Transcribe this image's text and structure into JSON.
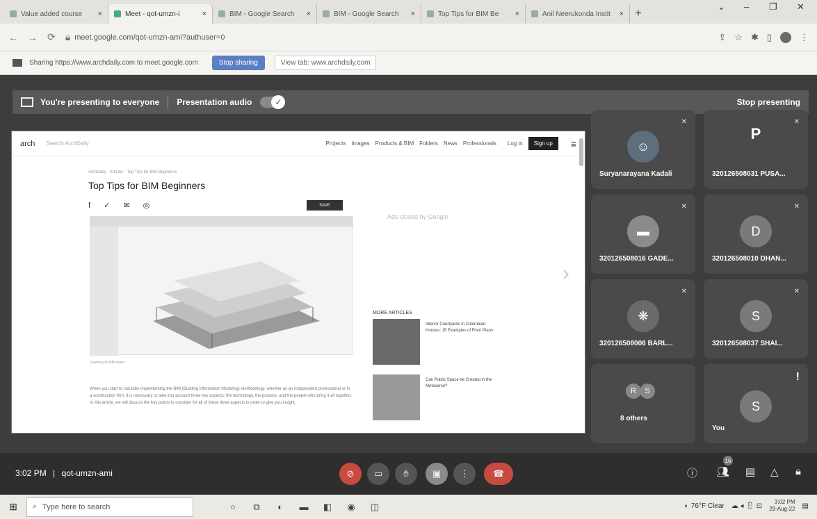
{
  "browser": {
    "tabs": [
      {
        "label": "Value added course",
        "active": false
      },
      {
        "label": "Meet - qot-umzn-i",
        "active": true
      },
      {
        "label": "BIM - Google Search",
        "active": false
      },
      {
        "label": "BIM - Google Search",
        "active": false
      },
      {
        "label": "Top Tips for BIM Be",
        "active": false
      },
      {
        "label": "Anil Neerukonda Instit",
        "active": false
      }
    ],
    "url": "meet.google.com/qot-umzn-ami?authuser=0",
    "sharing_text": "Sharing https://www.archdaily.com to meet.google.com",
    "stop_sharing_label": "Stop sharing",
    "view_tab_label": "View tab: www.archdaily.com"
  },
  "presenting": {
    "message": "You're presenting to everyone",
    "audio_label": "Presentation audio",
    "stop_label": "Stop presenting"
  },
  "shared_page": {
    "logo": "arch",
    "search_placeholder": "Search ArchDaily",
    "nav": [
      "Projects",
      "Images",
      "Products & BIM",
      "Folders",
      "News",
      "Professionals"
    ],
    "login_label": "Log in",
    "signup_label": "Sign up",
    "breadcrumb": "ArchDaily · Articles · Top Tips for BIM Beginners",
    "article_title": "Top Tips for BIM Beginners",
    "save_label": "SAVE",
    "caption": "Courtesy of BIM object",
    "body": "When you start to consider implementing the BIM (Building Information Modeling) methodology, whether as an independent professional or in a construction firm, it is necessary to take into account three key aspects: the technology, the process, and the people who bring it all together. In this article, we will discuss the key points to consider for all of these three aspects in order to give you insight.",
    "ad_text": "Ads closed by Google",
    "more_articles_heading": "MORE ARTICLES",
    "more_articles": [
      {
        "title": "Interior Courtyards in Colombian Houses: 15 Examples of Floor Plans"
      },
      {
        "title": "Can Public Space be Created in the Metaverse?"
      }
    ]
  },
  "participants": [
    {
      "name": "Suryanarayana Kadali",
      "type": "photo"
    },
    {
      "name": "320126508031 PUSA...",
      "type": "letter",
      "letter": "P"
    },
    {
      "name": "320126508016 GADE...",
      "type": "photo"
    },
    {
      "name": "320126508010 DHAN...",
      "type": "letter",
      "letter": "D"
    },
    {
      "name": "320126508006 BARL...",
      "type": "photo"
    },
    {
      "name": "320126508037 SHAI...",
      "type": "letter",
      "letter": "S"
    },
    {
      "name": "8 others",
      "type": "group",
      "letters": [
        "R",
        "S"
      ]
    },
    {
      "name": "You",
      "type": "letter",
      "letter": "S"
    }
  ],
  "bottombar": {
    "time": "3:02 PM",
    "separator": "|",
    "meeting_code": "qot-umzn-ami",
    "participant_count": "16"
  },
  "taskbar": {
    "search_placeholder": "Type here to search",
    "weather": "76°F Clear",
    "time": "3:02 PM",
    "date": "29-Aug-22"
  },
  "colors": {
    "meet_bg": "#3d3d3d",
    "tile_bg": "#4a4a4a",
    "stop_sharing_bg": "#5a7fc4",
    "hangup": "#c94a3e"
  }
}
